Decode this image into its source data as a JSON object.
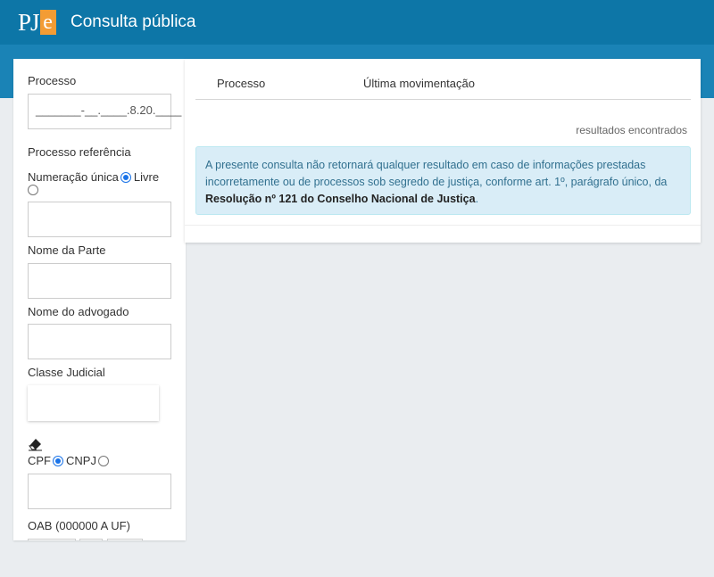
{
  "header": {
    "logo_text": "PJ",
    "logo_accent": "e",
    "title": "Consulta pública"
  },
  "form": {
    "processo_label": "Processo",
    "processo_mask": "_______-__.____.8.20.____",
    "processo_referencia_label": "Processo referência",
    "radio_numeracao_label": "Numeração única",
    "radio_livre_label": "Livre",
    "nome_parte_label": "Nome da Parte",
    "nome_advogado_label": "Nome do advogado",
    "classe_judicial_label": "Classe Judicial",
    "cpf_label": "CPF",
    "cnpj_label": "CNPJ",
    "oab_label": "OAB (000000 A UF)"
  },
  "results": {
    "col_processo": "Processo",
    "col_ultima": "Última movimentação",
    "found_text": "resultados encontrados",
    "notice_text": "A presente consulta não retornará qualquer resultado em caso de informações prestadas incorretamente ou de processos sob segredo de justiça, conforme art. 1º, parágrafo único, da ",
    "notice_bold": "Resolução nº 121 do Conselho Nacional de Justiça",
    "notice_end": "."
  },
  "colors": {
    "header": "#0d76a7",
    "band": "#1a83b6",
    "logo_accent": "#f39c34",
    "alert_bg": "#d9edf7"
  },
  "icons": {
    "eraser": "eraser-icon"
  }
}
